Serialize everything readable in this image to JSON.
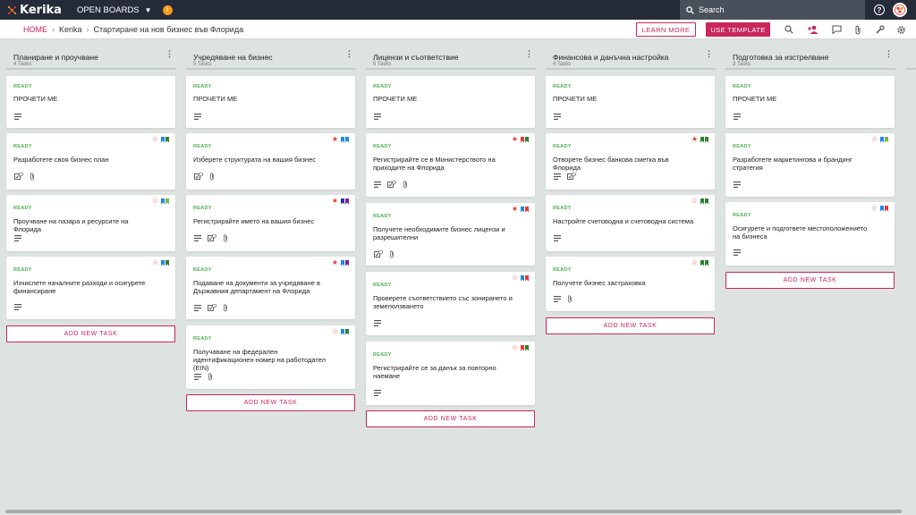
{
  "app": {
    "name": "Kerika"
  },
  "topbar": {
    "open_boards": "OPEN BOARDS",
    "search_placeholder": "Search"
  },
  "breadcrumb": {
    "home": "HOME",
    "org": "Kerika",
    "board": "Стартиране на нов бизнес във Флорида"
  },
  "actions": {
    "learn_more": "LEARN MORE",
    "use_template": "USE TEMPLATE"
  },
  "colors": {
    "accent": "#c8265c",
    "ready": "#4caf50",
    "star_red": "#e53935",
    "blue": "#1e88e5",
    "green": "#2e7d32",
    "red_bm": "#e53935",
    "navy": "#283593",
    "purple": "#7b1fa2",
    "light_green": "#7cb342"
  },
  "add_task_label": "ADD NEW TASK",
  "columns": [
    {
      "title": "Планиране и проучване",
      "count": "4 Tasks",
      "cards": [
        {
          "status": "READY",
          "title": "ПРОЧЕТИ МЕ"
        },
        {
          "status": "READY",
          "title": "Разработете своя бизнес план"
        },
        {
          "status": "READY",
          "title": "Проучване на пазара и ресурсите на Флорида"
        },
        {
          "status": "READY",
          "title": "Изчислете началните разходи и осигурете финансиране"
        }
      ]
    },
    {
      "title": "Учредяване на бизнес",
      "count": "5 Tasks",
      "cards": [
        {
          "status": "READY",
          "title": "ПРОЧЕТИ МЕ"
        },
        {
          "status": "READY",
          "title": "Изберете структурата на вашия бизнес"
        },
        {
          "status": "READY",
          "title": "Регистрирайте името на вашия бизнес"
        },
        {
          "status": "READY",
          "title": "Подаване на документи за учредяване в Държавния департамент на Флорида"
        },
        {
          "status": "READY",
          "title": "Получаване на федерален идентификационен номер на работодател (EIN)"
        }
      ]
    },
    {
      "title": "Лицензи и съответствие",
      "count": "5 Tasks",
      "cards": [
        {
          "status": "READY",
          "title": "ПРОЧЕТИ МЕ"
        },
        {
          "status": "READY",
          "title": "Регистрирайте се в Министерството на приходите на Флорида"
        },
        {
          "status": "READY",
          "title": "Получете необходимите бизнес лицензи и разрешителни"
        },
        {
          "status": "READY",
          "title": "Проверете съответствието със зонирането и земеползването"
        },
        {
          "status": "READY",
          "title": "Регистрирайте се за данък за повторно наемане"
        }
      ]
    },
    {
      "title": "Финансова и данъчна настройка",
      "count": "4 Tasks",
      "cards": [
        {
          "status": "READY",
          "title": "ПРОЧЕТИ МЕ"
        },
        {
          "status": "READY",
          "title": "Отворете бизнес банкова сметка във Флорида"
        },
        {
          "status": "READY",
          "title": "Настройте счетоводна и счетоводна система"
        },
        {
          "status": "READY",
          "title": "Получете бизнес застраховка"
        }
      ]
    },
    {
      "title": "Подготовка за изстрелване",
      "count": "3 Tasks",
      "cards": [
        {
          "status": "READY",
          "title": "ПРОЧЕТИ МЕ"
        },
        {
          "status": "READY",
          "title": "Разработете маркетингова и брандинг стратегия"
        },
        {
          "status": "READY",
          "title": "Осигурете и подгответе местоположението на бизнеса"
        }
      ]
    }
  ]
}
